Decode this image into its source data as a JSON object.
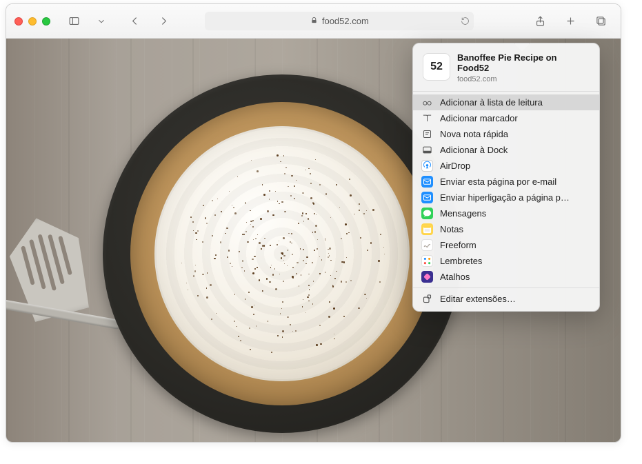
{
  "window": {
    "url_display": "food52.com"
  },
  "share": {
    "thumb_text": "52",
    "title": "Banoffee Pie Recipe on Food52",
    "domain": "food52.com",
    "items": [
      {
        "key": "reading-list",
        "label": "Adicionar à lista de leitura",
        "highlight": true,
        "icon": "glasses-icon"
      },
      {
        "key": "bookmark",
        "label": "Adicionar marcador",
        "highlight": false,
        "icon": "book-icon"
      },
      {
        "key": "quick-note",
        "label": "Nova nota rápida",
        "highlight": false,
        "icon": "note-square-icon"
      },
      {
        "key": "add-to-dock",
        "label": "Adicionar à Dock",
        "highlight": false,
        "icon": "dock-icon"
      },
      {
        "key": "airdrop",
        "label": "AirDrop",
        "highlight": false,
        "icon": "airdrop-icon"
      },
      {
        "key": "mail",
        "label": "Enviar esta página por e-mail",
        "highlight": false,
        "icon": "mail-icon"
      },
      {
        "key": "link-mail",
        "label": "Enviar hiperligação a página p…",
        "highlight": false,
        "icon": "mail-icon"
      },
      {
        "key": "messages",
        "label": "Mensagens",
        "highlight": false,
        "icon": "messages-icon"
      },
      {
        "key": "notes",
        "label": "Notas",
        "highlight": false,
        "icon": "notes-icon"
      },
      {
        "key": "freeform",
        "label": "Freeform",
        "highlight": false,
        "icon": "freeform-icon"
      },
      {
        "key": "reminders",
        "label": "Lembretes",
        "highlight": false,
        "icon": "reminders-icon"
      },
      {
        "key": "shortcuts",
        "label": "Atalhos",
        "highlight": false,
        "icon": "shortcuts-icon"
      }
    ],
    "footer_label": "Editar extensões…"
  }
}
